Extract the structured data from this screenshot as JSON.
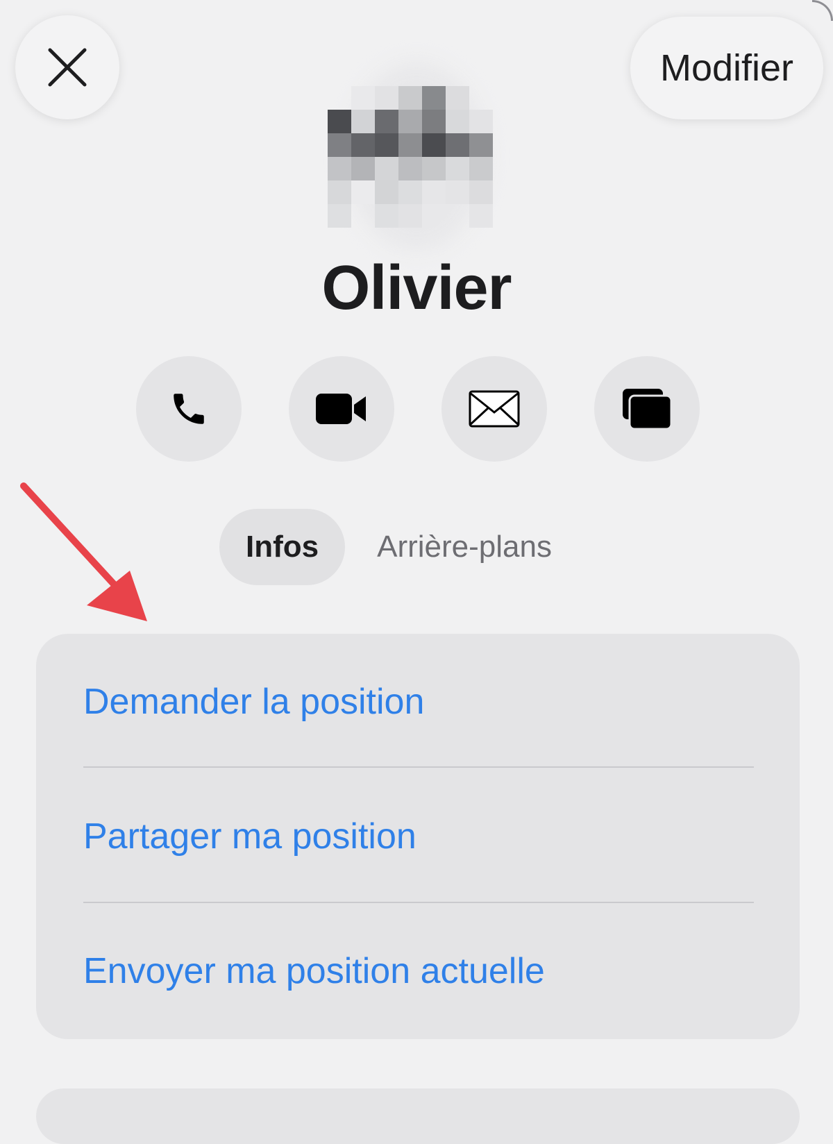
{
  "header": {
    "close_icon": "close-icon",
    "edit_label": "Modifier"
  },
  "contact": {
    "name": "Olivier",
    "avatar": "pixelated-avatar"
  },
  "actions": [
    {
      "name": "call",
      "icon": "phone-icon"
    },
    {
      "name": "video",
      "icon": "video-camera-icon"
    },
    {
      "name": "mail",
      "icon": "envelope-icon"
    },
    {
      "name": "screen-share",
      "icon": "screen-share-icon"
    }
  ],
  "tabs": {
    "active": "Infos",
    "inactive": "Arrière-plans"
  },
  "location_card": {
    "items": [
      "Demander la position",
      "Partager ma position",
      "Envoyer ma position actuelle"
    ]
  },
  "colors": {
    "background": "#f1f1f2",
    "card": "#e4e4e6",
    "link_blue": "#2f80e8",
    "arrow_red": "#e8434a"
  }
}
